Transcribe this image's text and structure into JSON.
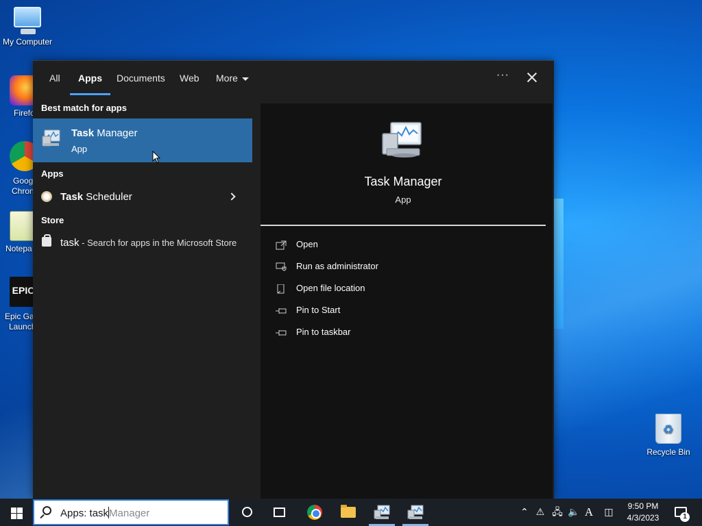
{
  "desktop": {
    "icons": [
      {
        "label": "My Computer"
      },
      {
        "label": "Firefo"
      },
      {
        "label": "Goog"
      },
      {
        "label": "Chron"
      },
      {
        "label": "Notepa"
      },
      {
        "label": "Epic Ga"
      },
      {
        "label": "Launch"
      },
      {
        "label": "Recycle Bin"
      }
    ]
  },
  "search_panel": {
    "tabs": [
      {
        "label": "All"
      },
      {
        "label": "Apps"
      },
      {
        "label": "Documents"
      },
      {
        "label": "Web"
      },
      {
        "label": "More"
      }
    ],
    "active_tab": "Apps",
    "more_options": "···",
    "best_match_header": "Best match for apps",
    "best_match": {
      "title_bold": "Task",
      "title_rest": " Manager",
      "subtitle": "App"
    },
    "apps_header": "Apps",
    "apps": [
      {
        "title_bold": "Task",
        "title_rest": " Scheduler"
      }
    ],
    "store_header": "Store",
    "store_item": {
      "query": "task",
      "description": " - Search for apps in the Microsoft Store"
    },
    "preview": {
      "title": "Task Manager",
      "subtitle": "App",
      "actions": [
        {
          "label": "Open",
          "icon": "open-icon"
        },
        {
          "label": "Run as administrator",
          "icon": "shield-icon"
        },
        {
          "label": "Open file location",
          "icon": "file-location-icon"
        },
        {
          "label": "Pin to Start",
          "icon": "pin-icon"
        },
        {
          "label": "Pin to taskbar",
          "icon": "pin-icon"
        }
      ]
    }
  },
  "taskbar": {
    "search_query": "Apps: task",
    "search_completion": "Manager",
    "clock_time": "9:50 PM",
    "clock_date": "4/3/2023",
    "input_indicator": "A",
    "notification_count": "1"
  },
  "colors": {
    "accent": "#4aa2ff",
    "selected_bg": "#2b6ca6",
    "panel_bg": "#1f1f1f",
    "preview_bg": "#121212",
    "taskbar_bg": "#1b1f26"
  }
}
